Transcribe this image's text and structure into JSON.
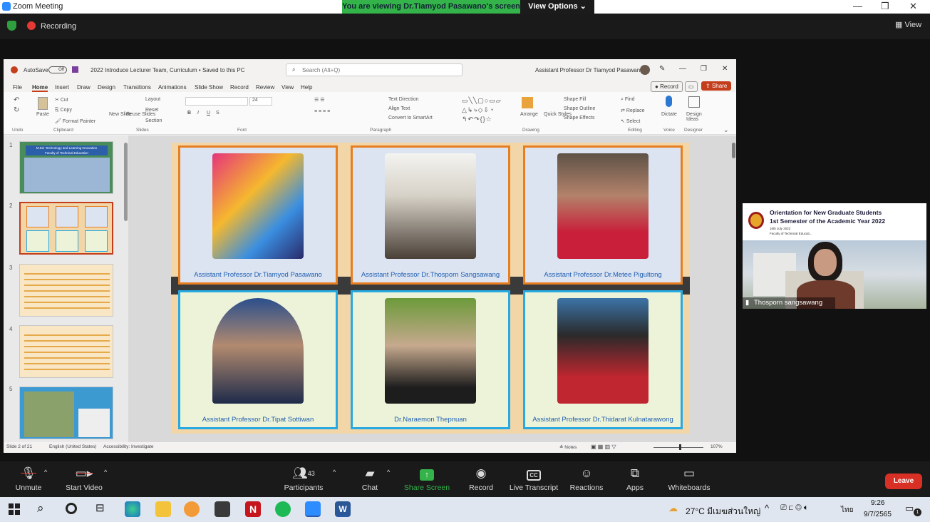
{
  "window": {
    "title": "Zoom Meeting",
    "banner": "You are viewing Dr.Tiamyod Pasawano's screen",
    "view_options": "View Options"
  },
  "zoom_top": {
    "recording": "Recording",
    "view": "View"
  },
  "ppt": {
    "autosave": "AutoSave",
    "autosave_state": "Off",
    "doc_title": "2022 Introduce Lecturer Team, Curriculum • Saved to this PC",
    "search_placeholder": "Search (Alt+Q)",
    "user": "Assistant Professor Dr Tiamyod Pasawano",
    "tabs": [
      "File",
      "Home",
      "Insert",
      "Draw",
      "Design",
      "Transitions",
      "Animations",
      "Slide Show",
      "Record",
      "Review",
      "View",
      "Help"
    ],
    "record_btn": "Record",
    "share_btn": "Share",
    "ribbon": {
      "undo": "Undo",
      "clipboard": "Clipboard",
      "paste": "Paste",
      "cut": "Cut",
      "copy": "Copy",
      "format_painter": "Format Painter",
      "slides": "Slides",
      "new_slide": "New Slide",
      "reuse_slides": "Reuse Slides",
      "layout": "Layout",
      "reset": "Reset",
      "section": "Section",
      "font": "Font",
      "font_size": "24",
      "paragraph": "Paragraph",
      "text_direction": "Text Direction",
      "align_text": "Align Text",
      "smartart": "Convert to SmartArt",
      "drawing": "Drawing",
      "arrange": "Arrange",
      "quick_styles": "Quick Styles",
      "shape_fill": "Shape Fill",
      "shape_outline": "Shape Outline",
      "shape_effects": "Shape Effects",
      "editing": "Editing",
      "find": "Find",
      "replace": "Replace",
      "select": "Select",
      "voice": "Voice",
      "dictate": "Dictate",
      "designer": "Designer",
      "design_ideas": "Design Ideas"
    },
    "thumbnails": [
      {
        "num": "1",
        "title": "M.Ed. Technology and Learning Innovation",
        "sub": "Faculty of Technical Education"
      },
      {
        "num": "2",
        "title": "",
        "sub": ""
      },
      {
        "num": "3",
        "title": "",
        "sub": ""
      },
      {
        "num": "4",
        "title": "",
        "sub": ""
      },
      {
        "num": "5",
        "title": "",
        "sub": ""
      }
    ],
    "slide_cards": [
      {
        "caption": "Assistant Professor Dr.Tiamyod Pasawano"
      },
      {
        "caption": "Assistant Professor Dr.Thosporn Sangsawang"
      },
      {
        "caption": "Assistant Professor Dr.Metee Pigultong"
      },
      {
        "caption": "Assistant Professor Dr.Tipat Sottiwan"
      },
      {
        "caption": "Dr.Naraemon Thepnuan"
      },
      {
        "caption": "Assistant Professor Dr.Thidarat Kulnatarawong"
      }
    ],
    "status": {
      "slide": "Slide 2 of 21",
      "language": "English (United States)",
      "accessibility": "Accessibility: Investigate",
      "notes": "Notes",
      "zoom": "107%"
    }
  },
  "video_tile": {
    "line1": "Orientation for New Graduate Students",
    "line2": "1st Semester of the Academic Year 2022",
    "line3": "16th July 2022",
    "line4": "Faculty of Technical Educati...",
    "name": "Thosporn sangsawang"
  },
  "zoom_bar": {
    "unmute": "Unmute",
    "start_video": "Start Video",
    "participants": "Participants",
    "participants_count": "43",
    "chat": "Chat",
    "share_screen": "Share Screen",
    "record": "Record",
    "live_transcript": "Live Transcript",
    "reactions": "Reactions",
    "apps": "Apps",
    "whiteboards": "Whiteboards",
    "leave": "Leave"
  },
  "taskbar": {
    "weather": "27°C  มีเมฆส่วนใหญ่",
    "lang": "ไทย",
    "time": "9:26",
    "date": "9/7/2565",
    "notif": "1"
  },
  "colors": {
    "zoom_green": "#34b34a",
    "leave_red": "#d93025",
    "office_red": "#c43e1c",
    "card_orange": "#e67e22",
    "card_blue": "#27a9e1"
  }
}
